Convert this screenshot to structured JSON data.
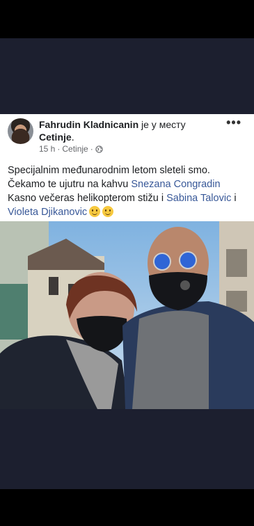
{
  "post": {
    "author": "Fahrudin Kladnicanin",
    "action": "je у месту",
    "place": "Cetinje",
    "time": "15 h",
    "location": "Cetinje",
    "more_label": "•••",
    "text_line1": "Specijalnim međunarodnim letom sleteli smo.",
    "text_line2_a": "Čekamo te ujutru na kahvu ",
    "mention1": "Snezana Congradin",
    "text_line3_a": "Kasno večeras helikopterom stižu i ",
    "mention2": "Sabina Talovic",
    "text_line3_b": " i",
    "mention3": "Violeta Djikanovic"
  },
  "colors": {
    "mention": "#385898",
    "background": "#1c1f2f"
  },
  "icons": [
    "globe-icon",
    "smile-emoji-icon",
    "more-icon"
  ]
}
